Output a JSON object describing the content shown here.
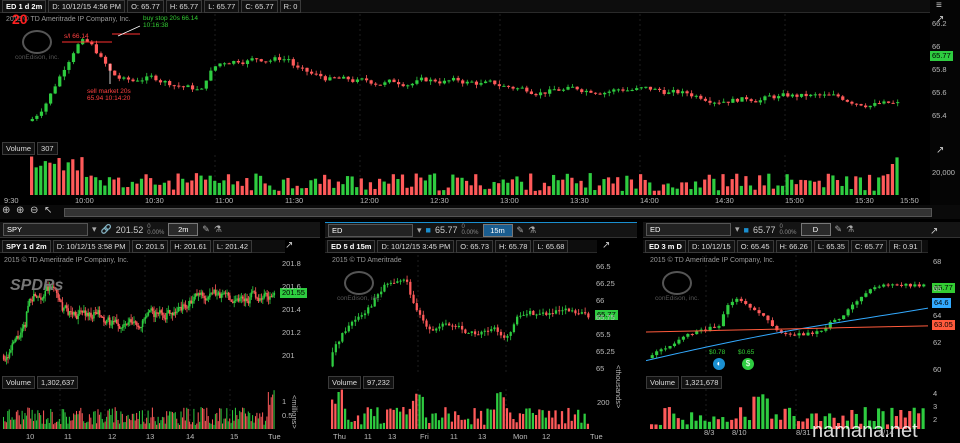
{
  "top": {
    "header": {
      "symbol": "ED 1 d 2m",
      "date": "D: 10/12/15 4:56 PM",
      "open": "O: 65.77",
      "high": "H: 65.77",
      "low": "L: 65.77",
      "close": "C: 65.77",
      "range": "R: 0"
    },
    "copyright": "2015 © TD Ameritrade IP Company, Inc.",
    "big_number": "20",
    "company_logo": "conEdison, inc.",
    "annotations": {
      "buy_stop": "buy stop 20s 66.14",
      "buy_time": "10:16:38",
      "sell_limit": "s/l 66.14",
      "sell_market": "sell market 20s",
      "sell_detail": "65.94 10:14:20"
    },
    "price_ticks": [
      "66.2",
      "66",
      "65.8",
      "65.6",
      "65.4"
    ],
    "price_tag": "65.77",
    "volume_label": "Volume",
    "volume_value": "307",
    "volume_tick": "20,000",
    "time_ticks": [
      "9:30",
      "10:00",
      "10:30",
      "11:00",
      "11:30",
      "12:00",
      "12:30",
      "13:00",
      "13:30",
      "14:00",
      "14:30",
      "15:00",
      "15:30",
      "15:50"
    ]
  },
  "panels": [
    {
      "toolbar": {
        "symbol": "SPY",
        "price": "201.52",
        "change": "0",
        "pct": "0.00%",
        "agg": "2m"
      },
      "header": {
        "symbol": "SPY 1 d 2m",
        "date": "D: 10/12/15 3:58 PM",
        "open": "O: 201.5",
        "high": "H: 201.61",
        "low": "L: 201.42"
      },
      "copyright": "2015 © TD Ameritrade IP Company, Inc.",
      "logo": "SPDRs",
      "price_ticks": [
        "201.8",
        "201.6",
        "201.4",
        "201.2",
        "201"
      ],
      "price_tag": "201.55",
      "volume_label": "Volume",
      "volume_value": "1,302,637",
      "vol_ticks": [
        "1",
        "0.5"
      ],
      "vol_unit": "<millions>",
      "x_ticks": [
        "10",
        "11",
        "12",
        "13",
        "14",
        "15",
        "Tue"
      ]
    },
    {
      "toolbar": {
        "symbol": "ED",
        "price": "65.77",
        "change": "0",
        "pct": "0.00%",
        "agg": "15m"
      },
      "header": {
        "symbol": "ED 5 d 15m",
        "date": "D: 10/12/15 3:45 PM",
        "open": "O: 65.73",
        "high": "H: 65.78",
        "low": "L: 65.68"
      },
      "copyright": "2015 © TD Ameritrade",
      "logo": "conEdison, inc.",
      "price_ticks": [
        "66.5",
        "66.25",
        "66",
        "65.75",
        "65.5",
        "65.25",
        "65"
      ],
      "price_tag": "65.77",
      "volume_label": "Volume",
      "volume_value": "97,232",
      "vol_ticks": [
        "200"
      ],
      "vol_unit": "<thousands>",
      "x_ticks": [
        "Thu",
        "11",
        "13",
        "Fri",
        "11",
        "13",
        "Mon",
        "12",
        "Tue"
      ]
    },
    {
      "toolbar": {
        "symbol": "ED",
        "price": "65.77",
        "change": "0",
        "pct": "0.00%",
        "agg": "D"
      },
      "header": {
        "symbol": "ED 3 m D",
        "date": "D: 10/12/15",
        "open": "O: 65.45",
        "high": "H: 66.26",
        "low": "L: 65.35",
        "close": "C: 65.77",
        "range": "R: 0.91"
      },
      "copyright": "2015 © TD Ameritrade IP Company, Inc.",
      "logo": "conEdison, inc.",
      "price_ticks": [
        "68",
        "66",
        "64",
        "62",
        "60"
      ],
      "price_tags": [
        {
          "label": "65.77",
          "color": "#33cc33"
        },
        {
          "label": "64.6",
          "color": "#33aaff"
        },
        {
          "label": "63.05",
          "color": "#ff5a3c"
        }
      ],
      "dividends": [
        "$0.78",
        "$0.65"
      ],
      "volume_label": "Volume",
      "volume_value": "1,321,678",
      "vol_ticks": [
        "4",
        "3",
        "2"
      ],
      "x_ticks": [
        "8/3",
        "8/10",
        "8/31",
        "9/14"
      ]
    }
  ],
  "footer_watermark": "namana.net",
  "colors": {
    "up": "#2ecc40",
    "down": "#ff5a5a",
    "grid": "#333333",
    "bg": "#000000"
  }
}
